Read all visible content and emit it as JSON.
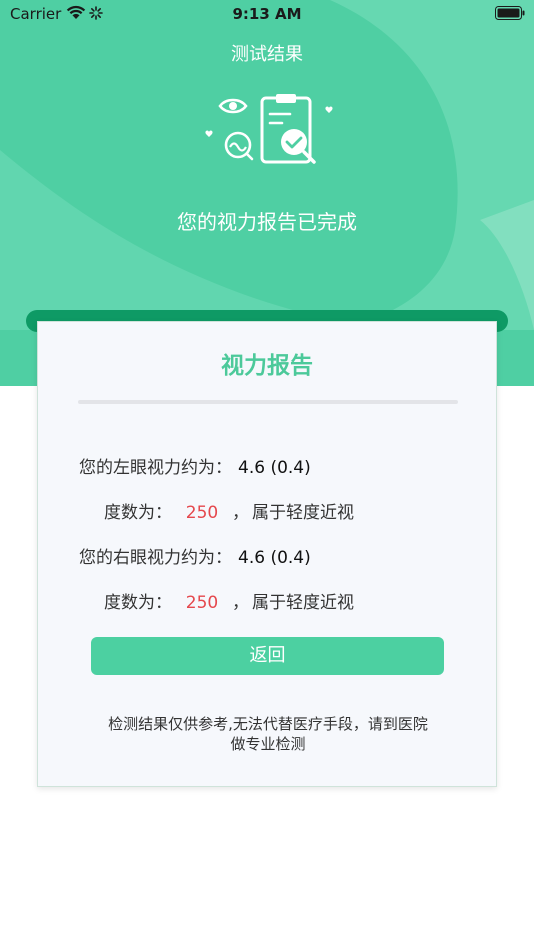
{
  "status_bar": {
    "carrier": "Carrier",
    "time": "9:13 AM"
  },
  "nav": {
    "title": "测试结果"
  },
  "hero": {
    "subtitle": "您的视力报告已完成",
    "illustration_icon": "eye-report-icon"
  },
  "card": {
    "title": "视力报告",
    "left_eye": {
      "label": "您的左眼视力约为：",
      "value": "4.6 (0.4)",
      "degree_label": "度数为：",
      "degree_value": "250",
      "separator": "，",
      "description": "属于轻度近视"
    },
    "right_eye": {
      "label": "您的右眼视力约为：",
      "value": "4.6 (0.4)",
      "degree_label": "度数为：",
      "degree_value": "250",
      "separator": "，",
      "description": "属于轻度近视"
    },
    "back_button_label": "返回",
    "disclaimer_line1": "检测结果仅供参考,无法代替医疗手段，请到医院",
    "disclaimer_line2": "做专业检测"
  },
  "colors": {
    "hero_green": "#4fcfa3",
    "accent_green": "#4cd0a1",
    "strip_dark_green": "#0e9a65",
    "degree_red": "#e5484d"
  }
}
